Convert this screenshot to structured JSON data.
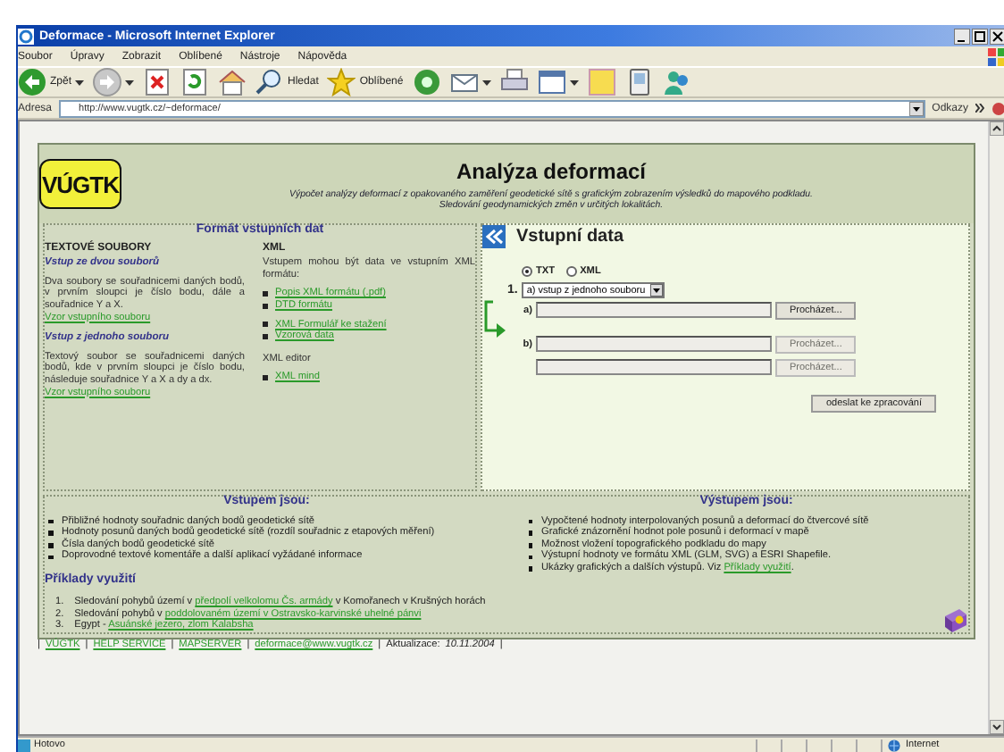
{
  "window": {
    "title": "Deformace - Microsoft Internet Explorer"
  },
  "menu": [
    "Soubor",
    "Úpravy",
    "Zobrazit",
    "Oblíbené",
    "Nástroje",
    "Nápověda"
  ],
  "toolbar": [
    {
      "kind": "back",
      "label": "Zpět",
      "dropdown": true
    },
    {
      "kind": "forward",
      "dropdown": true
    },
    {
      "kind": "stop"
    },
    {
      "kind": "refresh"
    },
    {
      "kind": "home"
    },
    {
      "kind": "search",
      "label": "Hledat"
    },
    {
      "kind": "favorites",
      "label": "Oblíbené"
    },
    {
      "kind": "media"
    },
    {
      "kind": "mail",
      "dropdown": true
    },
    {
      "kind": "print"
    },
    {
      "kind": "edit",
      "dropdown": true
    },
    {
      "kind": "note"
    },
    {
      "kind": "device"
    },
    {
      "kind": "people"
    }
  ],
  "address": {
    "label": "Adresa",
    "url": "http://www.vugtk.cz/~deformace/",
    "links_label": "Odkazy"
  },
  "header": {
    "logo": "VÚGTK",
    "title": "Analýza deformací",
    "subtitle_lines": [
      "Výpočet analýzy deformací z opakovaného zaměření geodetické sítě s grafickým zobrazením výsledků do mapového podkladu.",
      "Sledování geodynamických změn v určitých lokalitách."
    ]
  },
  "format_panel": {
    "title": "Formát vstupních dat",
    "text_files": {
      "heading": "TEXTOVÉ SOUBORY",
      "sections": [
        {
          "title": "Vstup ze dvou souborů",
          "text": "Dva soubory se souřadnicemi daných bodů, v prvním sloupci je číslo bodu, dále a souřadnice Y a X.",
          "link": "Vzor vstupního souboru"
        },
        {
          "title": "Vstup z jednoho souboru",
          "text": "Textový soubor se souřadnicemi daných bodů, kde v prvním sloupci je číslo bodu, následuje souřadnice Y a X a dy a dx.",
          "link": "Vzor vstupního souboru"
        }
      ]
    },
    "xml": {
      "heading": "XML",
      "text": "Vstupem mohou být data ve vstupním XML formátu:",
      "link_groups": [
        [
          "Popis XML formátu (.pdf)",
          "DTD formátu"
        ],
        [
          "XML Formulář ke stažení",
          "Vzorová data"
        ]
      ],
      "editor_label": "XML editor",
      "editor_links": [
        "XML mind"
      ]
    }
  },
  "input_panel": {
    "title": "Vstupní data",
    "radios": [
      {
        "label": "TXT",
        "selected": true
      },
      {
        "label": "XML",
        "selected": false
      }
    ],
    "step": "1.",
    "select_value": "a) vstup z jednoho souboru",
    "files": [
      {
        "label": "a)",
        "button": "Procházet...",
        "disabled": false
      },
      {
        "label": "b)",
        "button": "Procházet...",
        "disabled": true
      },
      {
        "button": "Procházet...",
        "disabled": true
      }
    ],
    "submit": "odeslat ke zpracování"
  },
  "inputs": {
    "title": "Vstupem jsou:",
    "items": [
      {
        "text": "Přibližné hodnoty souřadnic daných bodů geodetické sítě"
      },
      {
        "text": "Hodnoty posunů daných bodů geodetické sítě (rozdíl souřadnic z etapových měření)"
      },
      {
        "text": "Čísla daných bodů geodetické sítě"
      },
      {
        "text": "Doprovodné textové komentáře a další aplikací vyžádané informace"
      }
    ]
  },
  "outputs": {
    "title": "Výstupem jsou:",
    "items": [
      {
        "text": "Vypočtené hodnoty interpolovaných posunů a deformací do čtvercové sítě"
      },
      {
        "text": "Grafické znázornění hodnot pole posunů i deformací v mapě"
      },
      {
        "text": "Možnost vložení topografického podkladu do mapy"
      },
      {
        "text": "Výstupní hodnoty ve formátu XML (GLM, SVG) a ESRI Shapefile."
      },
      {
        "text": "Ukázky grafických a dalších výstupů. Viz ",
        "link": "Příklady využití",
        "after": "."
      }
    ]
  },
  "examples": {
    "title": "Příklady využití",
    "items": [
      {
        "number": "1.",
        "text": "Sledování pohybů území v ",
        "link": "předpolí velkolomu Čs. armády",
        "after": " v Komořanech v Krušných horách"
      },
      {
        "number": "2.",
        "text": "Sledování pohybů v ",
        "link": "poddolovaném území v Ostravsko-karvinské uhelné pánvi"
      },
      {
        "number": "3.",
        "text": "Egypt - ",
        "link": "Asuánské jezero, zlom Kalabsha"
      }
    ]
  },
  "footer": {
    "separator": "|",
    "links": [
      "VÚGTK",
      "HELP SERVICE",
      "MAPSERVER",
      "deformace@www.vugtk.cz"
    ],
    "update_label": "Aktualizace:",
    "update_date": "10.11.2004"
  },
  "status_bar": {
    "text": "Hotovo",
    "zone": "Internet"
  }
}
